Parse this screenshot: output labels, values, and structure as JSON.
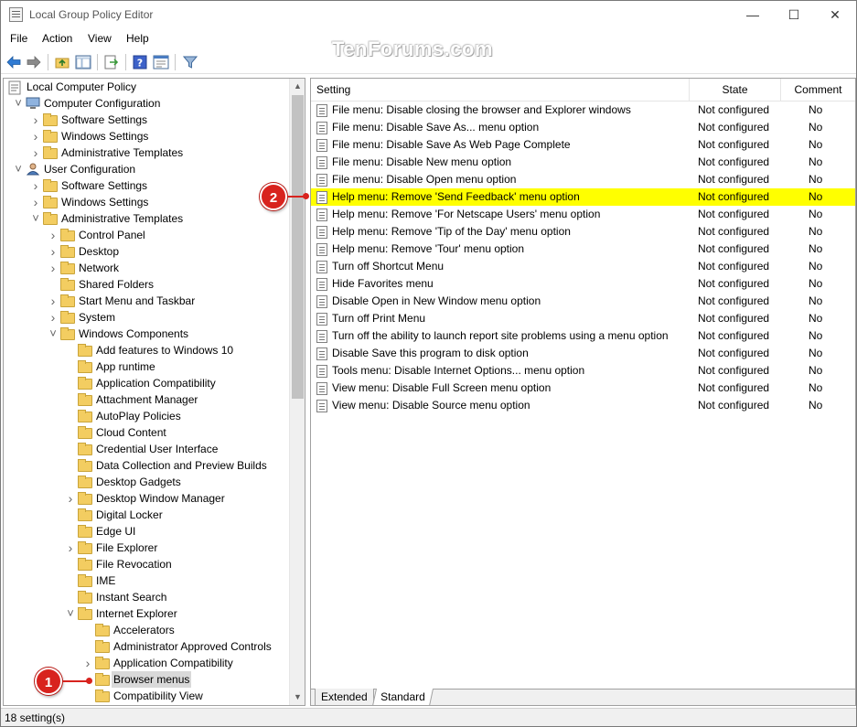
{
  "window": {
    "title": "Local Group Policy Editor",
    "min_icon": "minimize-icon",
    "max_icon": "maximize-icon",
    "close_icon": "close-icon"
  },
  "watermark": "TenForums.com",
  "menubar": [
    "File",
    "Action",
    "View",
    "Help"
  ],
  "toolbar": {
    "icons": [
      "back-arrow-icon",
      "forward-arrow-icon",
      "up-folder-icon",
      "show-hide-tree-icon",
      "export-list-icon",
      "help-icon",
      "properties-icon",
      "filter-icon"
    ]
  },
  "tree": [
    {
      "label": "Local Computer Policy",
      "depth": 0,
      "icon": "policy-icon",
      "expander": ""
    },
    {
      "label": "Computer Configuration",
      "depth": 1,
      "icon": "computer-icon",
      "expander": "open"
    },
    {
      "label": "Software Settings",
      "depth": 2,
      "icon": "folder-icon",
      "expander": "closed"
    },
    {
      "label": "Windows Settings",
      "depth": 2,
      "icon": "folder-icon",
      "expander": "closed"
    },
    {
      "label": "Administrative Templates",
      "depth": 2,
      "icon": "folder-icon",
      "expander": "closed"
    },
    {
      "label": "User Configuration",
      "depth": 1,
      "icon": "user-icon",
      "expander": "open"
    },
    {
      "label": "Software Settings",
      "depth": 2,
      "icon": "folder-icon",
      "expander": "closed"
    },
    {
      "label": "Windows Settings",
      "depth": 2,
      "icon": "folder-icon",
      "expander": "closed"
    },
    {
      "label": "Administrative Templates",
      "depth": 2,
      "icon": "folder-icon",
      "expander": "open"
    },
    {
      "label": "Control Panel",
      "depth": 3,
      "icon": "folder-icon",
      "expander": "closed"
    },
    {
      "label": "Desktop",
      "depth": 3,
      "icon": "folder-icon",
      "expander": "closed"
    },
    {
      "label": "Network",
      "depth": 3,
      "icon": "folder-icon",
      "expander": "closed"
    },
    {
      "label": "Shared Folders",
      "depth": 3,
      "icon": "folder-icon",
      "expander": ""
    },
    {
      "label": "Start Menu and Taskbar",
      "depth": 3,
      "icon": "folder-icon",
      "expander": "closed"
    },
    {
      "label": "System",
      "depth": 3,
      "icon": "folder-icon",
      "expander": "closed"
    },
    {
      "label": "Windows Components",
      "depth": 3,
      "icon": "folder-icon",
      "expander": "open"
    },
    {
      "label": "Add features to Windows 10",
      "depth": 4,
      "icon": "folder-icon",
      "expander": ""
    },
    {
      "label": "App runtime",
      "depth": 4,
      "icon": "folder-icon",
      "expander": ""
    },
    {
      "label": "Application Compatibility",
      "depth": 4,
      "icon": "folder-icon",
      "expander": ""
    },
    {
      "label": "Attachment Manager",
      "depth": 4,
      "icon": "folder-icon",
      "expander": ""
    },
    {
      "label": "AutoPlay Policies",
      "depth": 4,
      "icon": "folder-icon",
      "expander": ""
    },
    {
      "label": "Cloud Content",
      "depth": 4,
      "icon": "folder-icon",
      "expander": ""
    },
    {
      "label": "Credential User Interface",
      "depth": 4,
      "icon": "folder-icon",
      "expander": ""
    },
    {
      "label": "Data Collection and Preview Builds",
      "depth": 4,
      "icon": "folder-icon",
      "expander": ""
    },
    {
      "label": "Desktop Gadgets",
      "depth": 4,
      "icon": "folder-icon",
      "expander": ""
    },
    {
      "label": "Desktop Window Manager",
      "depth": 4,
      "icon": "folder-icon",
      "expander": "closed"
    },
    {
      "label": "Digital Locker",
      "depth": 4,
      "icon": "folder-icon",
      "expander": ""
    },
    {
      "label": "Edge UI",
      "depth": 4,
      "icon": "folder-icon",
      "expander": ""
    },
    {
      "label": "File Explorer",
      "depth": 4,
      "icon": "folder-icon",
      "expander": "closed"
    },
    {
      "label": "File Revocation",
      "depth": 4,
      "icon": "folder-icon",
      "expander": ""
    },
    {
      "label": "IME",
      "depth": 4,
      "icon": "folder-icon",
      "expander": ""
    },
    {
      "label": "Instant Search",
      "depth": 4,
      "icon": "folder-icon",
      "expander": ""
    },
    {
      "label": "Internet Explorer",
      "depth": 4,
      "icon": "folder-icon",
      "expander": "open"
    },
    {
      "label": "Accelerators",
      "depth": 5,
      "icon": "folder-icon",
      "expander": ""
    },
    {
      "label": "Administrator Approved Controls",
      "depth": 5,
      "icon": "folder-icon",
      "expander": ""
    },
    {
      "label": "Application Compatibility",
      "depth": 5,
      "icon": "folder-icon",
      "expander": "closed"
    },
    {
      "label": "Browser menus",
      "depth": 5,
      "icon": "folder-open-icon",
      "expander": "",
      "selected": true
    },
    {
      "label": "Compatibility View",
      "depth": 5,
      "icon": "folder-icon",
      "expander": ""
    }
  ],
  "list": {
    "headers": {
      "setting": "Setting",
      "state": "State",
      "comment": "Comment"
    },
    "rows": [
      {
        "setting": "File menu: Disable closing the browser and Explorer windows",
        "state": "Not configured",
        "comment": "No"
      },
      {
        "setting": "File menu: Disable Save As... menu option",
        "state": "Not configured",
        "comment": "No"
      },
      {
        "setting": "File menu: Disable Save As Web Page Complete",
        "state": "Not configured",
        "comment": "No"
      },
      {
        "setting": "File menu: Disable New menu option",
        "state": "Not configured",
        "comment": "No"
      },
      {
        "setting": "File menu: Disable Open menu option",
        "state": "Not configured",
        "comment": "No"
      },
      {
        "setting": "Help menu: Remove 'Send Feedback' menu option",
        "state": "Not configured",
        "comment": "No",
        "highlighted": true
      },
      {
        "setting": "Help menu: Remove 'For Netscape Users' menu option",
        "state": "Not configured",
        "comment": "No"
      },
      {
        "setting": "Help menu: Remove 'Tip of the Day' menu option",
        "state": "Not configured",
        "comment": "No"
      },
      {
        "setting": "Help menu: Remove 'Tour' menu option",
        "state": "Not configured",
        "comment": "No"
      },
      {
        "setting": "Turn off Shortcut Menu",
        "state": "Not configured",
        "comment": "No"
      },
      {
        "setting": "Hide Favorites menu",
        "state": "Not configured",
        "comment": "No"
      },
      {
        "setting": "Disable Open in New Window menu option",
        "state": "Not configured",
        "comment": "No"
      },
      {
        "setting": "Turn off Print Menu",
        "state": "Not configured",
        "comment": "No"
      },
      {
        "setting": "Turn off the ability to launch report site problems using a menu option",
        "state": "Not configured",
        "comment": "No"
      },
      {
        "setting": "Disable Save this program to disk option",
        "state": "Not configured",
        "comment": "No"
      },
      {
        "setting": "Tools menu: Disable Internet Options... menu option",
        "state": "Not configured",
        "comment": "No"
      },
      {
        "setting": "View menu: Disable Full Screen menu option",
        "state": "Not configured",
        "comment": "No"
      },
      {
        "setting": "View menu: Disable Source menu option",
        "state": "Not configured",
        "comment": "No"
      }
    ],
    "tabs": [
      "Extended",
      "Standard"
    ]
  },
  "status": "18 setting(s)",
  "callouts": [
    "1",
    "2"
  ],
  "colors": {
    "highlight": "#ffff00",
    "callout": "#d8231e",
    "selection": "#d9d9d9"
  }
}
